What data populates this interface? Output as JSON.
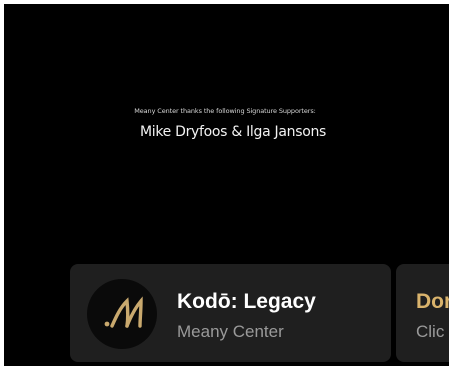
{
  "sponsor": {
    "thanks_text": "Meany Center thanks the following Signature Supporters:",
    "names": "Mike Dryfoos & Ilga Jansons"
  },
  "now_playing_card": {
    "title": "Kodō: Legacy",
    "subtitle": "Meany Center",
    "logo_icon": "meany-center-monogram-icon",
    "logo_color": "#c9a96e"
  },
  "next_card": {
    "title": "Dor",
    "subtitle": "Clic",
    "title_color": "#d9b36c"
  }
}
